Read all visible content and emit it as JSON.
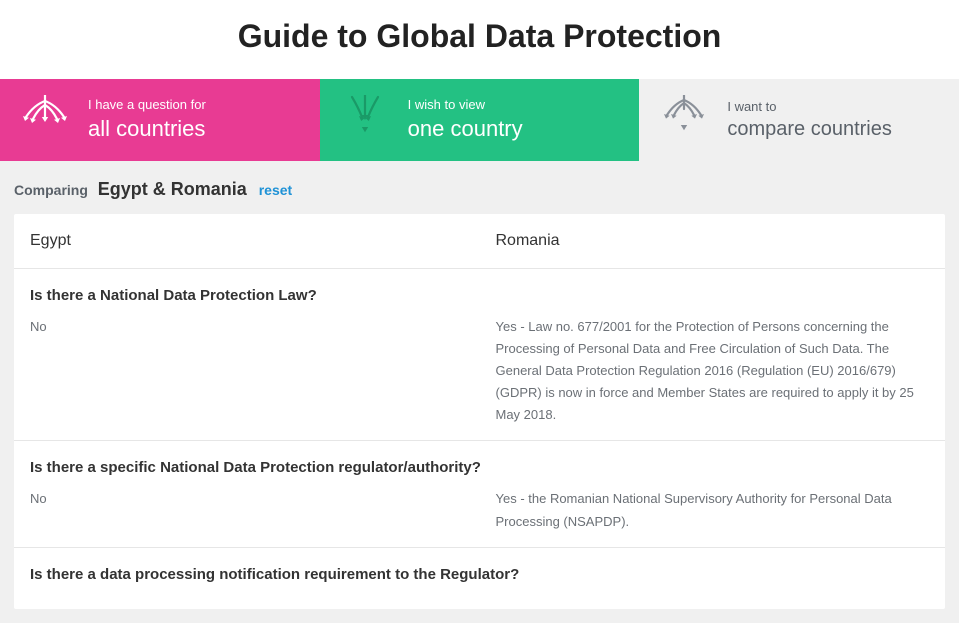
{
  "page_title": "Guide to Global Data Protection",
  "tabs": [
    {
      "line1": "I have a question for",
      "line2": "all countries"
    },
    {
      "line1": "I wish to view",
      "line2": "one country"
    },
    {
      "line1": "I want to",
      "line2": "compare countries"
    }
  ],
  "comparing": {
    "label": "Comparing",
    "value": "Egypt & Romania",
    "reset": "reset"
  },
  "country_headers": [
    "Egypt",
    "Romania"
  ],
  "questions": [
    {
      "q": "Is there a National Data Protection Law?",
      "answers": [
        "No",
        "Yes - Law no. 677/2001 for the Protection of Persons concerning the Processing of Personal Data and Free Circulation of Such Data. The General Data Protection Regulation 2016 (Regulation (EU) 2016/679) (GDPR) is now in force and Member States are required to apply it by 25 May 2018."
      ]
    },
    {
      "q": "Is there a specific National Data Protection regulator/authority?",
      "answers": [
        "No",
        "Yes - the Romanian National Supervisory Authority for Personal Data Processing (NSAPDP)."
      ]
    },
    {
      "q": "Is there a data processing notification requirement to the Regulator?",
      "answers": [
        "",
        ""
      ]
    }
  ]
}
